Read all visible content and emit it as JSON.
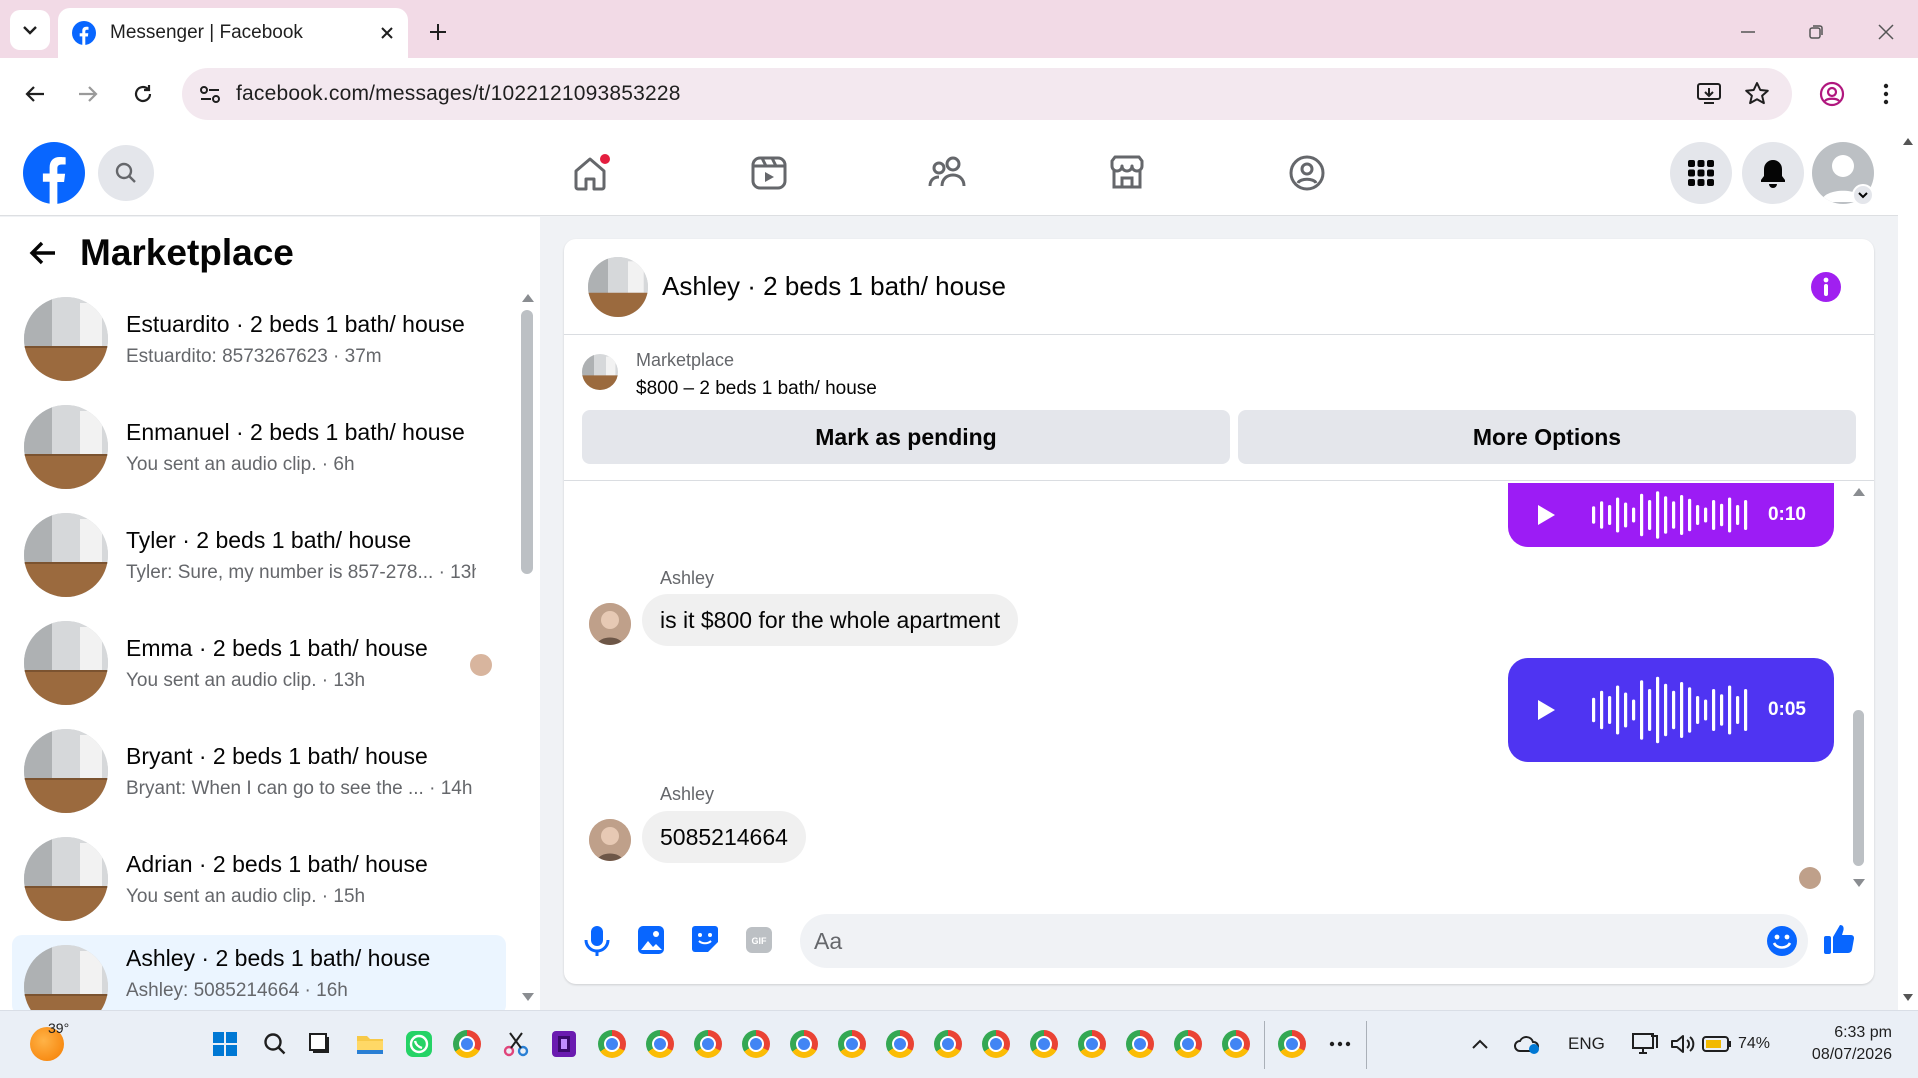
{
  "browser": {
    "tab_title": "Messenger | Facebook",
    "url": "facebook.com/messages/t/1022121093853228"
  },
  "left": {
    "heading": "Marketplace",
    "conversations": [
      {
        "name": "Estuardito · 2 beds 1 bath/ house",
        "sub": "Estuardito: 8573267623 · 37m"
      },
      {
        "name": "Enmanuel · 2 beds 1 bath/ house",
        "sub": "You sent an audio clip. · 6h"
      },
      {
        "name": "Tyler · 2 beds 1 bath/ house",
        "sub": "Tyler: Sure, my number is 857-278... · 13h"
      },
      {
        "name": "Emma · 2 beds 1 bath/ house",
        "sub": "You sent an audio clip. · 13h"
      },
      {
        "name": "Bryant · 2 beds 1 bath/ house",
        "sub": "Bryant: When I can go to see the ... · 14h"
      },
      {
        "name": "Adrian · 2 beds 1 bath/ house",
        "sub": "You sent an audio clip. · 15h"
      },
      {
        "name": "Ashley · 2 beds 1 bath/ house",
        "sub": "Ashley: 5085214664 · 16h"
      }
    ]
  },
  "chat": {
    "title": "Ashley · 2 beds 1 bath/ house",
    "marketplace_label": "Marketplace",
    "listing": "$800 – 2 beds 1 bath/ house",
    "mark_pending": "Mark as pending",
    "more_options": "More Options",
    "messages": [
      {
        "type": "audio",
        "duration": "0:10"
      },
      {
        "sender": "Ashley",
        "text": "is it $800 for the whole apartment"
      },
      {
        "type": "audio",
        "duration": "0:05"
      },
      {
        "sender": "Ashley",
        "text": "5085214664"
      }
    ],
    "input_placeholder": "Aa"
  },
  "taskbar": {
    "weather": "39°",
    "lang": "ENG",
    "battery": "74%",
    "time": "6:33 pm",
    "date": "08/07/2026"
  },
  "colors": {
    "fb_blue": "#0866ff",
    "audio_purple": "#9c1cf5",
    "audio_blue": "#4f34f2",
    "tab_bar": "#f2dae6"
  }
}
